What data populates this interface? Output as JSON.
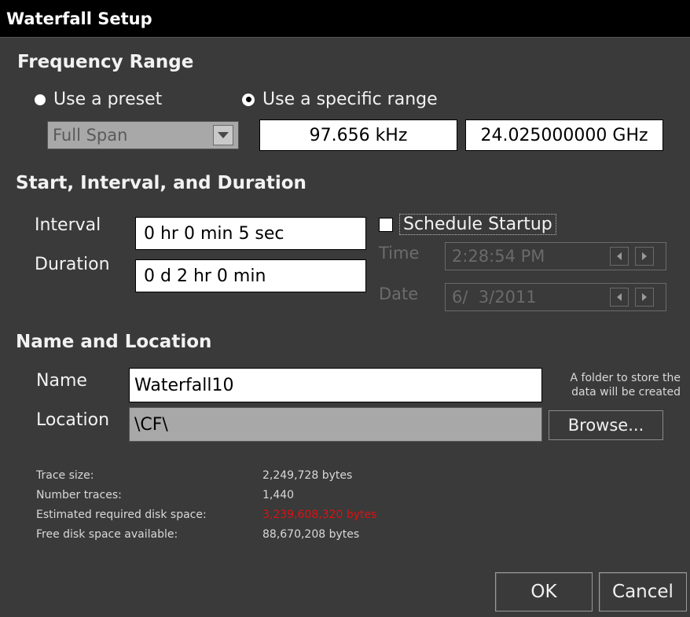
{
  "window": {
    "title": "Waterfall Setup"
  },
  "frequency_range": {
    "heading": "Frequency Range",
    "preset_radio_label": "Use a preset",
    "specific_radio_label": "Use a specific range",
    "selected_option": "specific",
    "preset_value": "Full Span",
    "start_frequency": "97.656 kHz",
    "stop_frequency": "24.025000000 GHz"
  },
  "timing": {
    "heading": "Start, Interval, and Duration",
    "interval_label": "Interval",
    "interval_value": "0 hr 0 min 5 sec",
    "duration_label": "Duration",
    "duration_value": "0 d 2 hr 0 min",
    "schedule_label": "Schedule Startup",
    "schedule_checked": false,
    "time_label": "Time",
    "time_value": "2:28:54 PM",
    "date_label": "Date",
    "date_value": "6/  3/2011"
  },
  "name_location": {
    "heading": "Name and Location",
    "name_label": "Name",
    "name_value": "Waterfall10",
    "location_label": "Location",
    "location_value": "\\CF\\",
    "note_line1": "A folder to store the",
    "note_line2": "data will be created",
    "browse_label": "Browse..."
  },
  "stats": {
    "trace_size_label": "Trace size:",
    "trace_size_value": "2,249,728 bytes",
    "number_traces_label": "Number traces:",
    "number_traces_value": "1,440",
    "required_space_label": "Estimated required disk space:",
    "required_space_value": "3,239,608,320 bytes",
    "free_space_label": "Free disk space available:",
    "free_space_value": "88,670,208 bytes",
    "warning_color": "#e01010"
  },
  "footer": {
    "ok_label": "OK",
    "cancel_label": "Cancel"
  }
}
